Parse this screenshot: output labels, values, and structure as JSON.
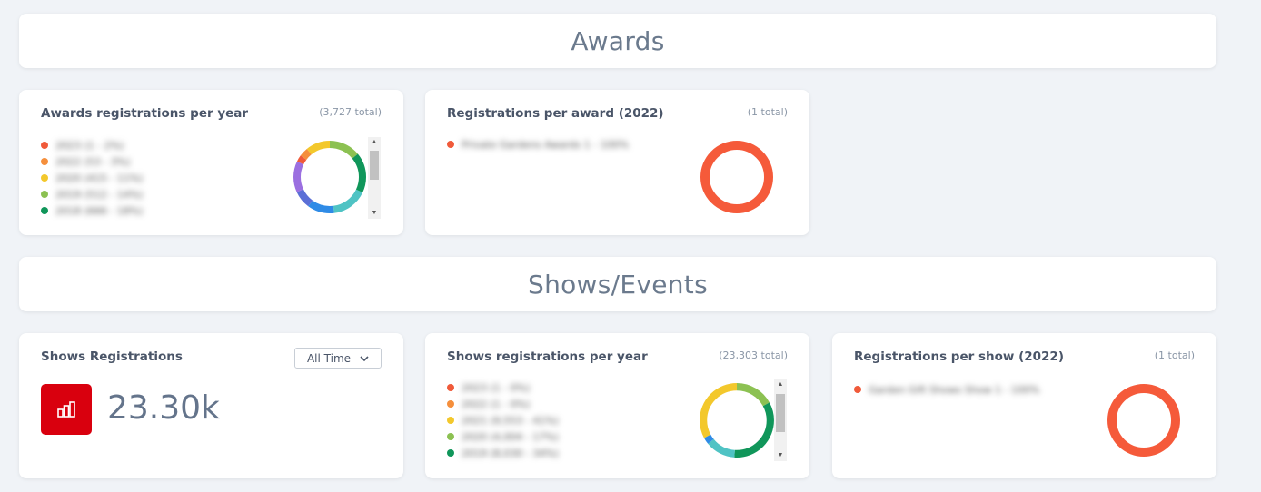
{
  "sections": {
    "awards_title": "Awards",
    "shows_title": "Shows/Events"
  },
  "awards_per_year": {
    "title": "Awards registrations per year",
    "total": "(3,727 total)",
    "legend": [
      {
        "label": "2023 (1 - 2%)",
        "color": "#f05a3a"
      },
      {
        "label": "2022 (53 - 3%)",
        "color": "#f58f3c"
      },
      {
        "label": "2020 (415 - 11%)",
        "color": "#f3c82c"
      },
      {
        "label": "2019 (512 - 14%)",
        "color": "#8cc152"
      },
      {
        "label": "2018 (666 - 18%)",
        "color": "#10965a"
      }
    ],
    "donut_segments": [
      {
        "color": "#8cc152",
        "value": 14
      },
      {
        "color": "#10965a",
        "value": 18
      },
      {
        "color": "#4fc3c4",
        "value": 16
      },
      {
        "color": "#2f8be6",
        "value": 12
      },
      {
        "color": "#5b6fd6",
        "value": 8
      },
      {
        "color": "#9b6fe0",
        "value": 14
      },
      {
        "color": "#f05a3a",
        "value": 3
      },
      {
        "color": "#f58f3c",
        "value": 4
      },
      {
        "color": "#f3c82c",
        "value": 11
      }
    ]
  },
  "awards_per_award": {
    "title": "Registrations per award (2022)",
    "total": "(1 total)",
    "legend": [
      {
        "label": "Private Gardens Awards 1 - 100%",
        "color": "#f05a3a"
      }
    ],
    "donut_color": "#f55a3a"
  },
  "shows_registrations": {
    "title": "Shows Registrations",
    "dropdown_value": "All Time",
    "value": "23.30k",
    "icon": "bar-chart-icon",
    "icon_color": "#d9000e"
  },
  "shows_per_year": {
    "title": "Shows registrations per year",
    "total": "(23,303 total)",
    "legend": [
      {
        "label": "2023 (1 - 0%)",
        "color": "#f05a3a"
      },
      {
        "label": "2022 (1 - 0%)",
        "color": "#f58f3c"
      },
      {
        "label": "2021 (9,553 - 41%)",
        "color": "#f3c82c"
      },
      {
        "label": "2020 (4,004 - 17%)",
        "color": "#8cc152"
      },
      {
        "label": "2019 (8,030 - 34%)",
        "color": "#10965a"
      }
    ],
    "donut_segments": [
      {
        "color": "#8cc152",
        "value": 17
      },
      {
        "color": "#10965a",
        "value": 34
      },
      {
        "color": "#4fc3c4",
        "value": 13
      },
      {
        "color": "#2f8be6",
        "value": 3
      },
      {
        "color": "#f3c82c",
        "value": 33
      }
    ]
  },
  "shows_per_show": {
    "title": "Registrations per show (2022)",
    "total": "(1 total)",
    "legend": [
      {
        "label": "Garden Gift Shows Show 1 - 100%",
        "color": "#f05a3a"
      }
    ],
    "donut_color": "#f55a3a"
  }
}
